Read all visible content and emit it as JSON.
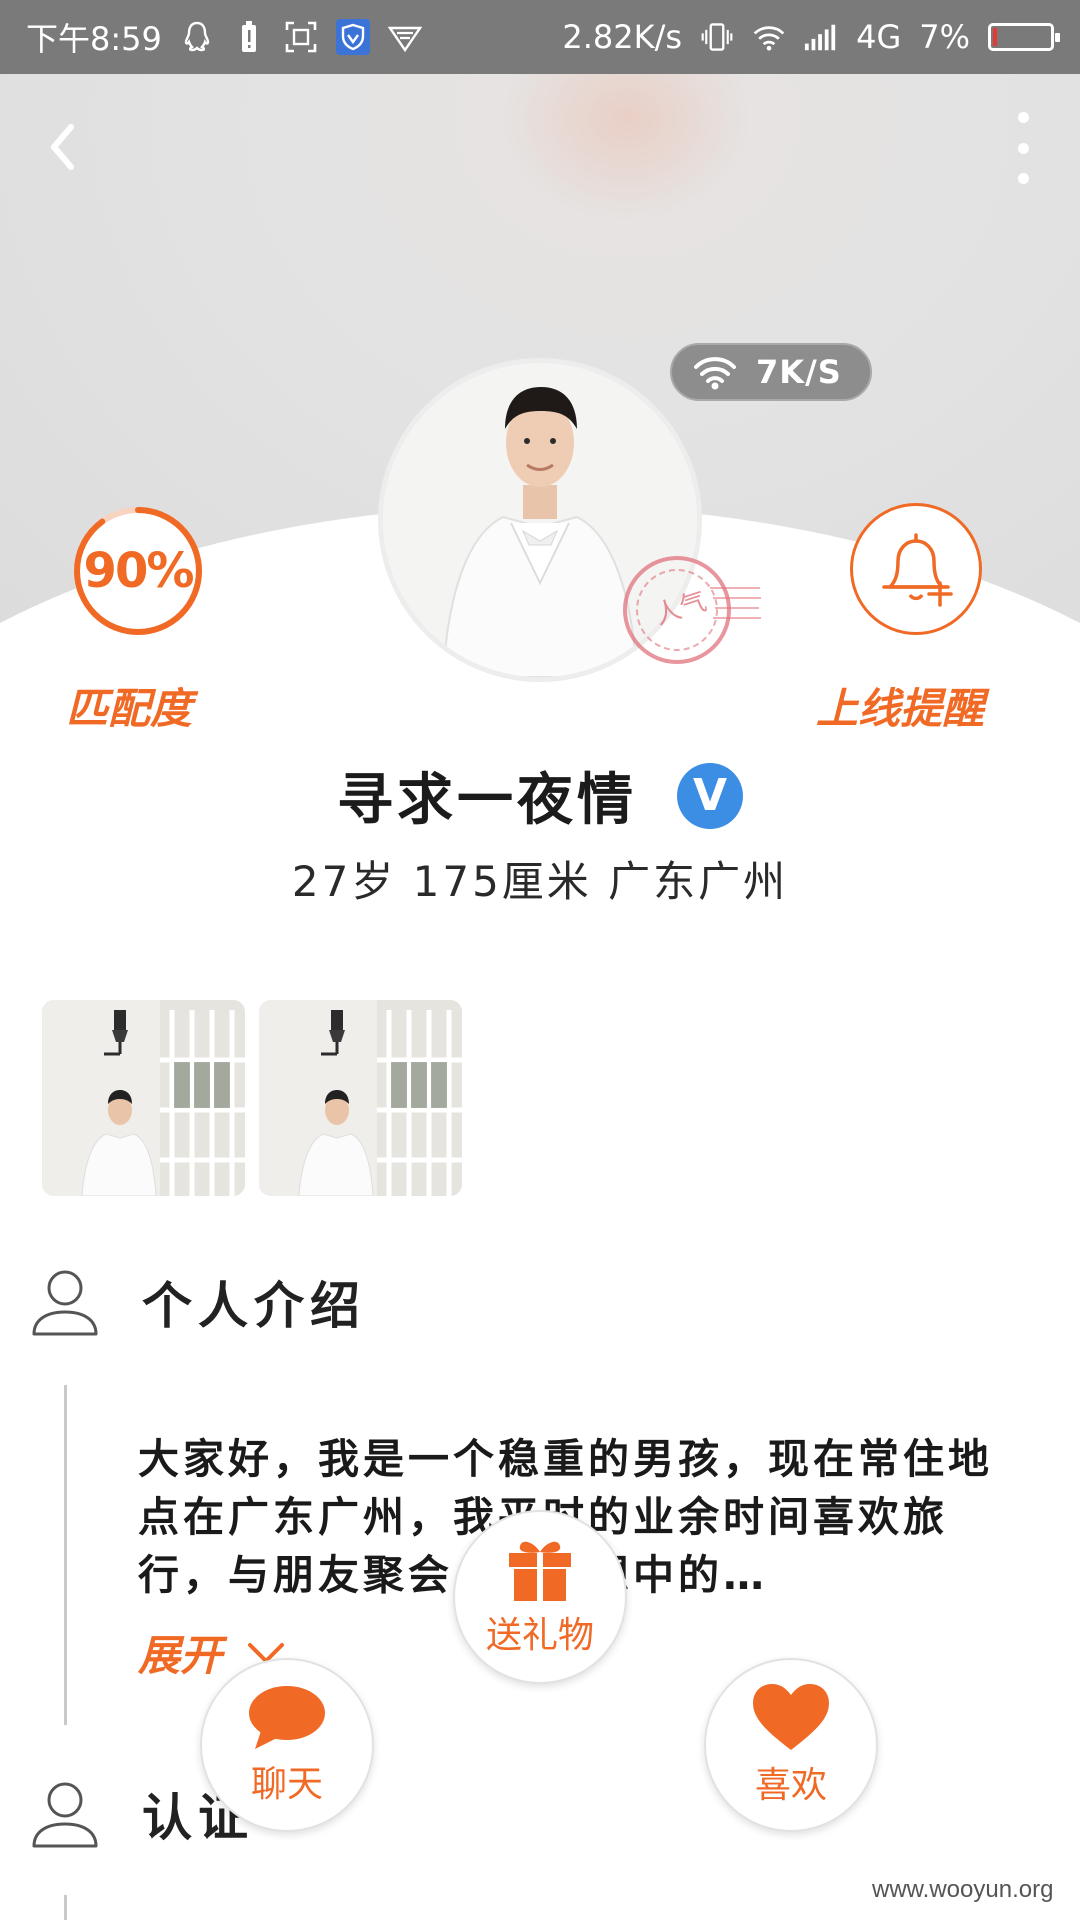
{
  "status_bar": {
    "time": "下午8:59",
    "net_speed": "2.82K/s",
    "network": "4G",
    "battery": "7%",
    "battery_level": 0.07
  },
  "header": {
    "speed_badge": "7K/S"
  },
  "profile": {
    "match_percent": "90%",
    "match_value": 0.9,
    "match_label": "匹配度",
    "remind_label": "上线提醒",
    "stamp_text": "人气",
    "nickname": "寻求一夜情",
    "verified_badge": "V",
    "info": "27岁 175厘米 广东广州"
  },
  "sections": {
    "intro_title": "个人介绍",
    "intro_text": "大家好，我是一个稳重的男孩，现在常住地点在广东广州，我平时的业余时间喜欢旅行，与朋友聚会，我理想中的…",
    "expand_label": "展开",
    "verify_title": "认证"
  },
  "actions": {
    "gift_label": "送礼物",
    "chat_label": "聊天",
    "like_label": "喜欢"
  },
  "watermark": "www.wooyun.org",
  "colors": {
    "accent": "#f06a26",
    "verified": "#3c8ee5",
    "status_bar": "#7a7a7a"
  }
}
